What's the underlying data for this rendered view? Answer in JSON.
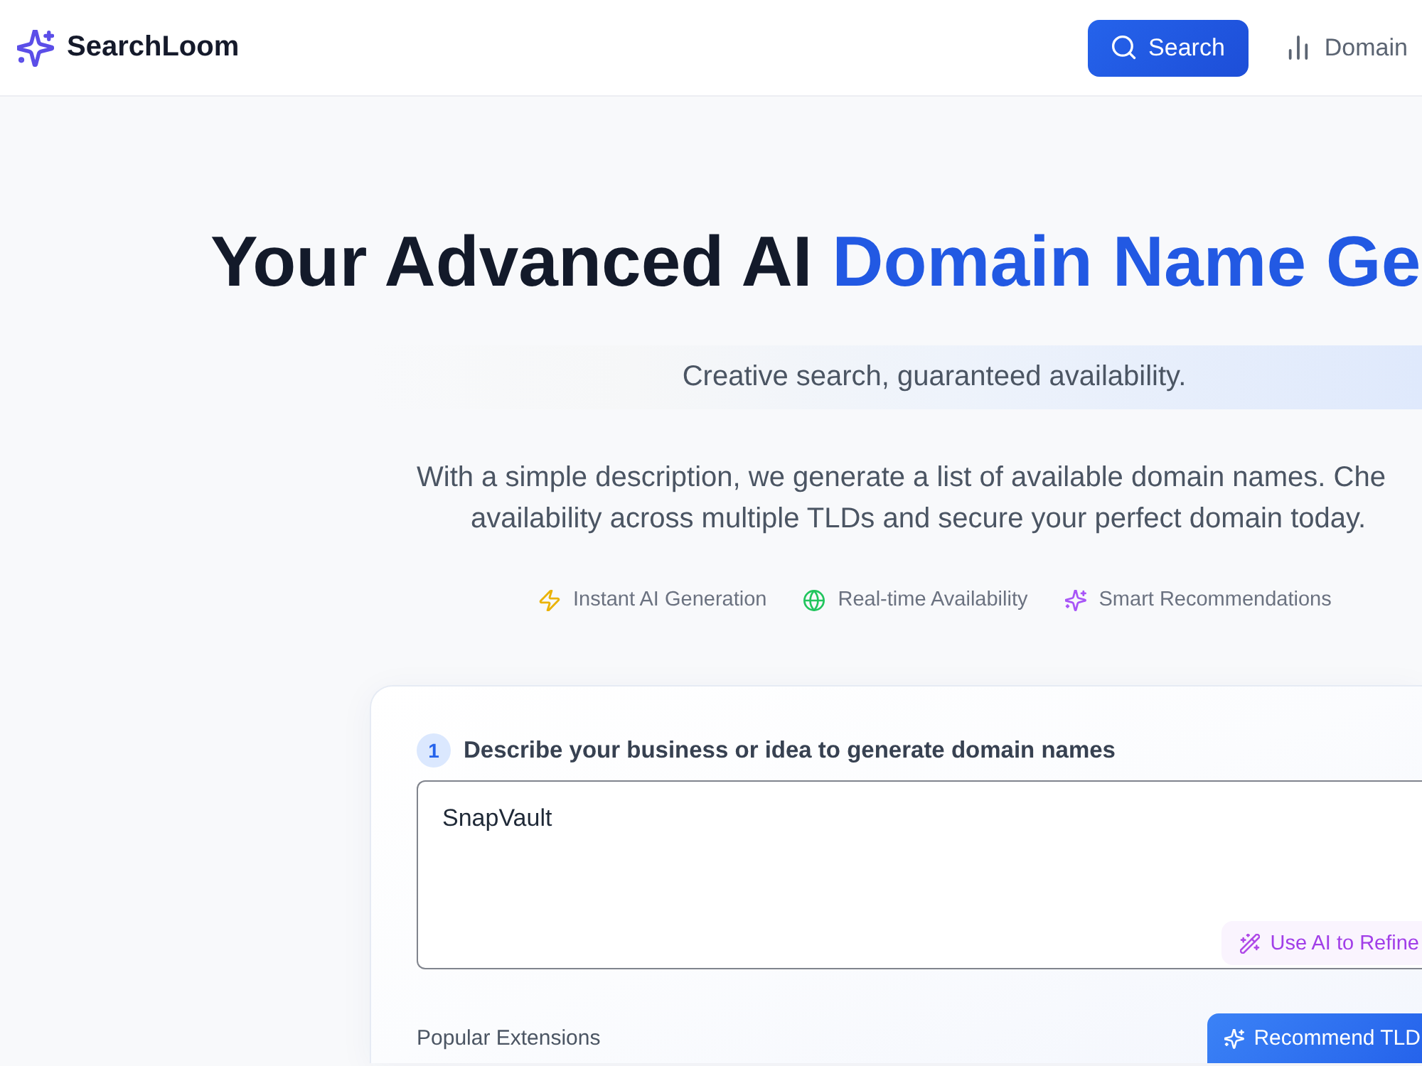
{
  "header": {
    "logo": "SearchLoom",
    "nav": [
      {
        "label": "Search",
        "selected": true
      },
      {
        "label": "Domain",
        "selected": false
      }
    ]
  },
  "hero": {
    "title": [
      {
        "text": "Your Advanced AI ",
        "kind": "plain"
      },
      {
        "text": "Domain Name Ge",
        "kind": "highlight"
      }
    ],
    "tagline": "Creative search, guaranteed availability.",
    "description": [
      "With a simple description, we generate a list of available domain names. Che",
      "availability across multiple TLDs and secure your perfect domain today."
    ],
    "features": [
      {
        "label": "Instant AI Generation"
      },
      {
        "label": "Real-time Availability"
      },
      {
        "label": "Smart Recommendations"
      }
    ]
  },
  "form": {
    "step": "1",
    "prompt": "Describe your business or idea to generate domain names",
    "input": {
      "value": "SnapVault"
    },
    "refine_button": "Use AI to Refine",
    "extensions_label": "Popular Extensions",
    "recommend_button": "Recommend TLD"
  }
}
